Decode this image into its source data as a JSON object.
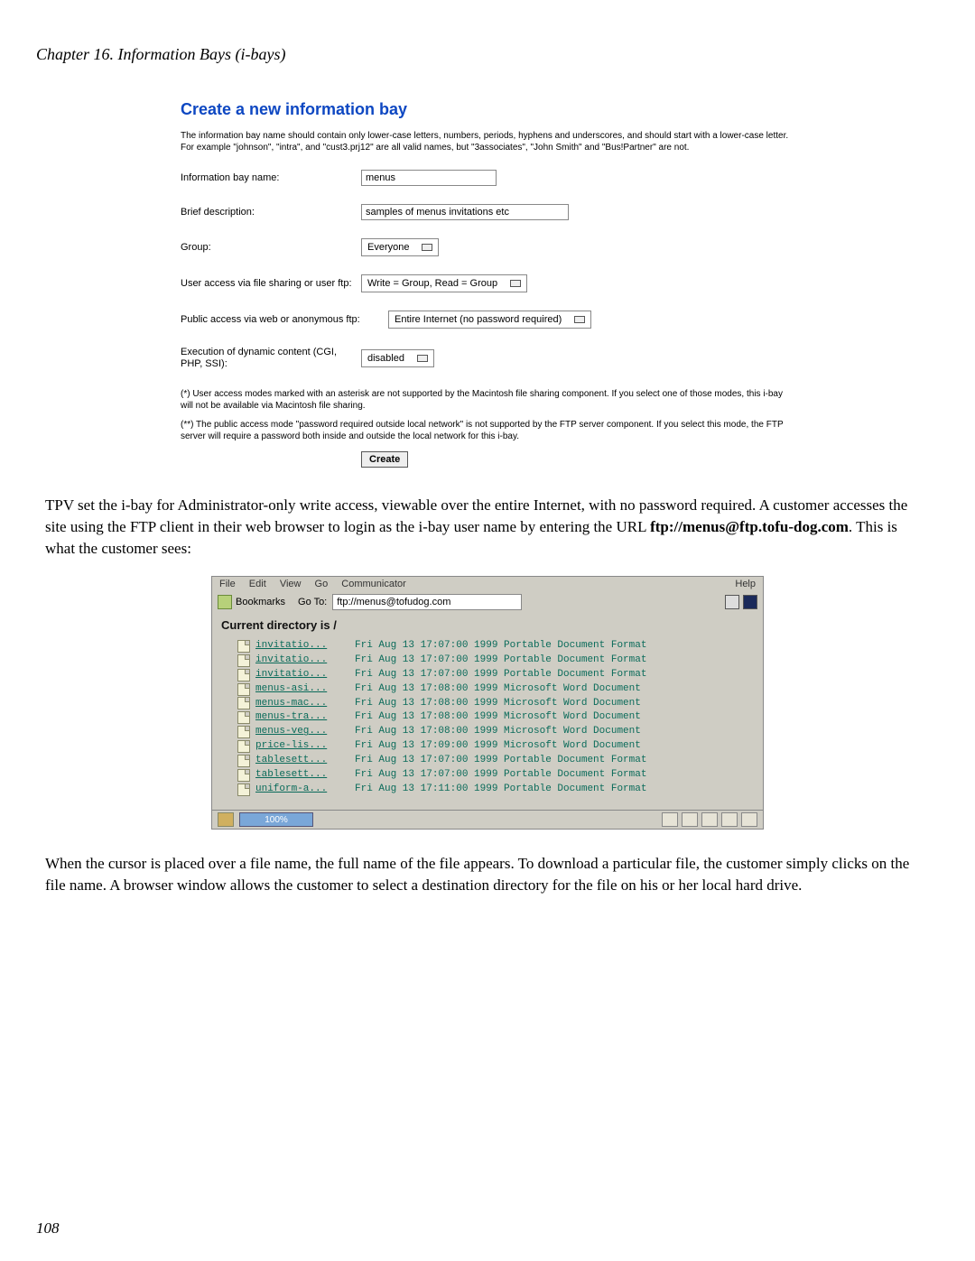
{
  "chapter_heading": "Chapter 16. Information Bays (i-bays)",
  "page_number": "108",
  "panel1": {
    "title": "Create a new information bay",
    "intro": "The information bay name should contain only lower-case letters, numbers, periods, hyphens and underscores, and should start with a lower-case letter. For example \"johnson\", \"intra\", and \"cust3.prj12\" are all valid names, but \"3associates\", \"John Smith\" and \"Bus!Partner\" are not.",
    "fields": {
      "name_label": "Information bay name:",
      "name_value": "menus",
      "desc_label": "Brief description:",
      "desc_value": "samples of menus invitations etc",
      "group_label": "Group:",
      "group_value": "Everyone",
      "ua_label": "User access via file sharing or user ftp:",
      "ua_value": "Write = Group, Read = Group",
      "pa_label": "Public access via web or anonymous ftp:",
      "pa_value": "Entire Internet (no password required)",
      "dyn_label": "Execution of dynamic content (CGI, PHP, SSI):",
      "dyn_value": "disabled"
    },
    "note1": "(*) User access modes marked with an asterisk are not supported by the Macintosh file sharing component. If you select one of those modes, this i-bay will not be available via Macintosh file sharing.",
    "note2": "(**) The public access mode \"password required outside local network\" is not supported by the FTP server component. If you select this mode, the FTP server will require a password both inside and outside the local network for this i-bay.",
    "create_btn": "Create"
  },
  "para1_a": "TPV set the i-bay for Administrator-only write access, viewable over the entire Internet, with no password required. A customer accesses the site using the FTP client in their web browser to login as the i-bay user name by entering the URL ",
  "para1_bold": "ftp://menus@ftp.tofu-dog.com",
  "para1_b": ". This is what the customer sees:",
  "panel2": {
    "menu": {
      "file": "File",
      "edit": "Edit",
      "view": "View",
      "go": "Go",
      "comm": "Communicator",
      "help": "Help"
    },
    "bookmarks": "Bookmarks",
    "goto": "Go To:",
    "url": "ftp://menus@tofudog.com",
    "dir_heading": "Current directory is /",
    "rows": [
      {
        "name": "invitatio...",
        "info": "Fri Aug 13 17:07:00 1999 Portable Document Format"
      },
      {
        "name": "invitatio...",
        "info": "Fri Aug 13 17:07:00 1999 Portable Document Format"
      },
      {
        "name": "invitatio...",
        "info": "Fri Aug 13 17:07:00 1999 Portable Document Format"
      },
      {
        "name": "menus-asi...",
        "info": "Fri Aug 13 17:08:00 1999 Microsoft Word Document"
      },
      {
        "name": "menus-mac...",
        "info": "Fri Aug 13 17:08:00 1999 Microsoft Word Document"
      },
      {
        "name": "menus-tra...",
        "info": "Fri Aug 13 17:08:00 1999 Microsoft Word Document"
      },
      {
        "name": "menus-veg...",
        "info": "Fri Aug 13 17:08:00 1999 Microsoft Word Document"
      },
      {
        "name": "price-lis...",
        "info": "Fri Aug 13 17:09:00 1999 Microsoft Word Document"
      },
      {
        "name": "tablesett...",
        "info": "Fri Aug 13 17:07:00 1999 Portable Document Format"
      },
      {
        "name": "tablesett...",
        "info": "Fri Aug 13 17:07:00 1999 Portable Document Format"
      },
      {
        "name": "uniform-a...",
        "info": "Fri Aug 13 17:11:00 1999 Portable Document Format"
      }
    ],
    "progress": "100%"
  },
  "para2": "When the cursor is placed over a file name, the full name of the file appears. To download a particular file, the customer simply clicks on the file name. A browser window allows the customer to select a destination directory for the file on his or her local hard drive."
}
